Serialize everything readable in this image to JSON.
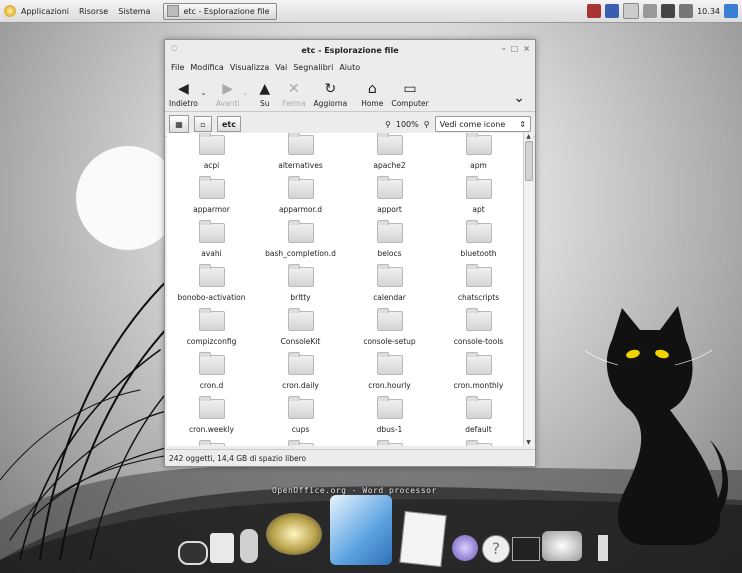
{
  "panel": {
    "menu_applications": "Applicazioni",
    "menu_places": "Risorse",
    "menu_system": "Sistema",
    "task_label": "etc - Esplorazione file",
    "clock": "10.34"
  },
  "window": {
    "title": "etc - Esplorazione file",
    "menu": [
      "File",
      "Modifica",
      "Visualizza",
      "Vai",
      "Segnalibri",
      "Aiuto"
    ],
    "toolbar": {
      "back": "Indietro",
      "forward": "Avanti",
      "up": "Su",
      "stop": "Ferma",
      "reload": "Aggiorna",
      "home": "Home",
      "computer": "Computer"
    },
    "location": {
      "path_button": "etc",
      "zoom": "100%",
      "view_mode": "Vedi come icone"
    },
    "files": [
      "acpi",
      "alternatives",
      "apache2",
      "apm",
      "apparmor",
      "apparmor.d",
      "apport",
      "apt",
      "avahi",
      "bash_completion.d",
      "belocs",
      "bluetooth",
      "bonobo-activation",
      "brltty",
      "calendar",
      "chatscripts",
      "compizconfig",
      "ConsoleKit",
      "console-setup",
      "console-tools",
      "cron.d",
      "cron.daily",
      "cron.hourly",
      "cron.monthly",
      "cron.weekly",
      "cups",
      "dbus-1",
      "default",
      "",
      "",
      "",
      ""
    ],
    "status": "242 oggetti, 14,4 GB di spazio libero"
  },
  "dock": {
    "label": "OpenOffice.org - Word processor"
  },
  "colors": {
    "cat": "#111111",
    "cat_eyes": "#f2d300",
    "panel_bg": "#e6e6e6"
  }
}
